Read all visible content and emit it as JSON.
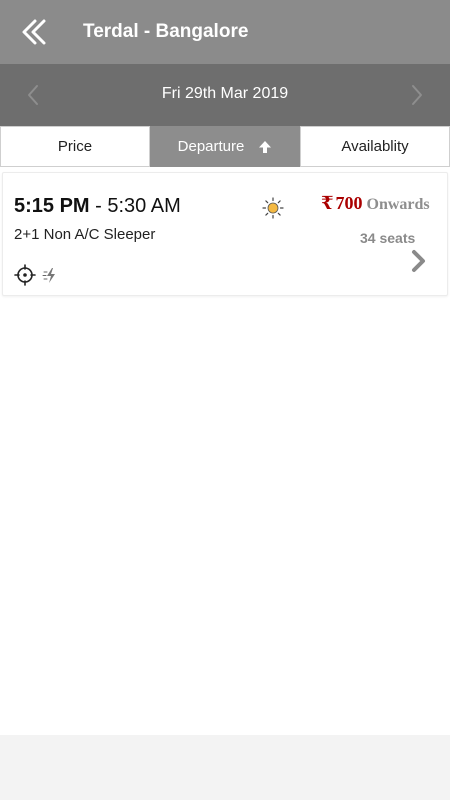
{
  "header": {
    "title": "Terdal - Bangalore",
    "back_icon": "double-chevron-left-icon"
  },
  "date_bar": {
    "date": "Fri 29th Mar 2019",
    "prev_icon": "chevron-left-icon",
    "next_icon": "chevron-right-icon"
  },
  "sort_tabs": [
    {
      "label": "Price",
      "active": false
    },
    {
      "label": "Departure",
      "active": true,
      "icon": "arrow-up-icon"
    },
    {
      "label": "Availablity",
      "active": false
    }
  ],
  "results": [
    {
      "departure": "5:15 PM",
      "separator": " - ",
      "arrival": "5:30 AM",
      "bus_type": "2+1 Non A/C Sleeper",
      "time_icon": "sun-icon",
      "currency": "₹",
      "price": "700",
      "price_suffix": "Onwards",
      "seats": "34 seats",
      "amenity_icons": [
        "gps-tracking-icon",
        "charging-point-icon"
      ]
    }
  ],
  "colors": {
    "header_bg": "#8b8b8b",
    "date_bar_bg": "#6e6e6e",
    "active_tab_bg": "#8d8d8d",
    "price_color": "#a00000",
    "muted_text": "#8a8a8a",
    "sun": "#f4b942"
  }
}
